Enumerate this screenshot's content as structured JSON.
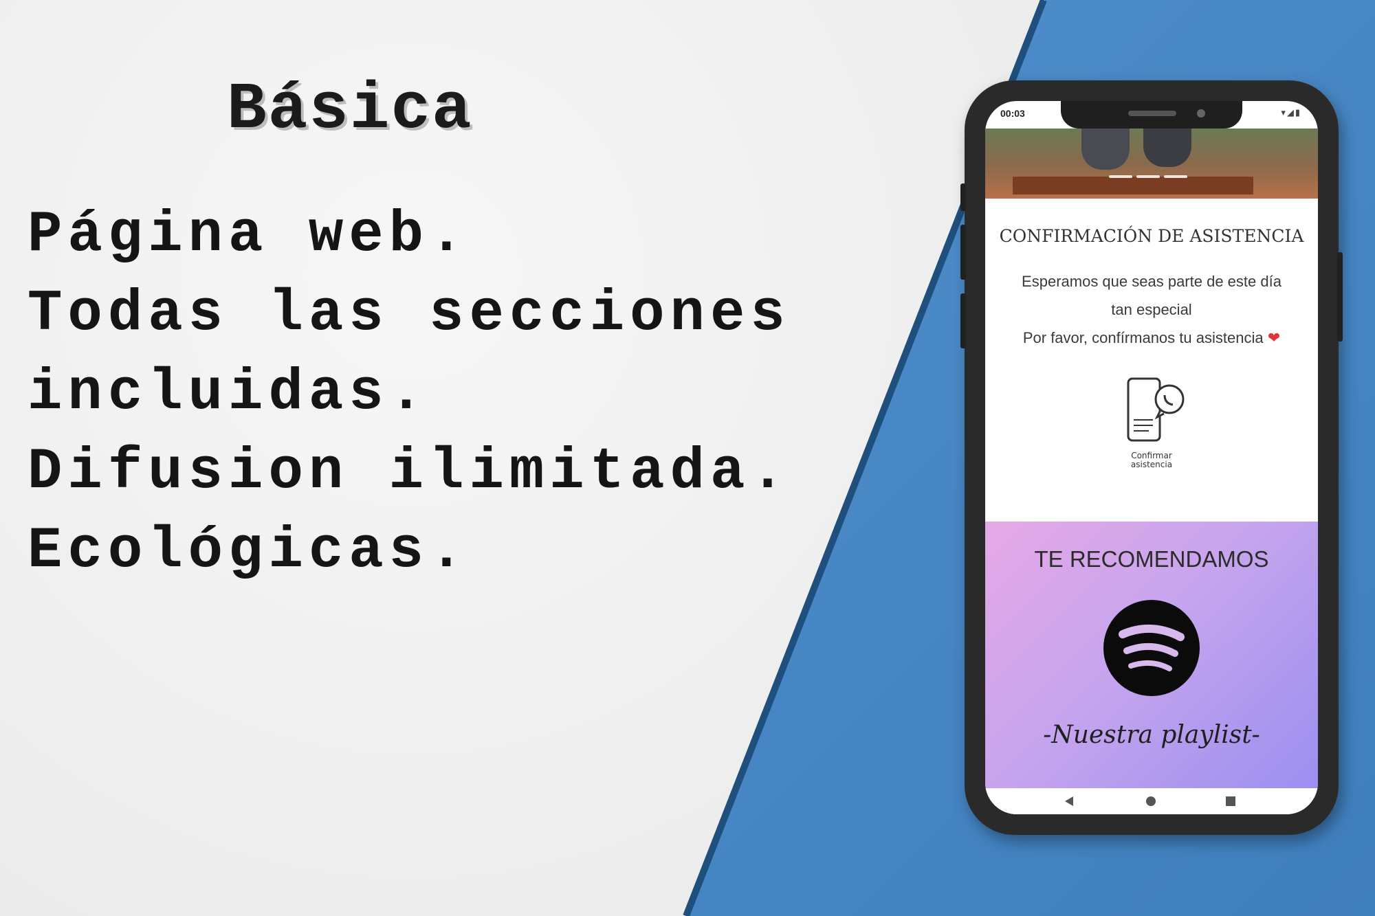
{
  "heading": "Básica",
  "features": [
    "Página web.",
    "Todas las secciones",
    "incluidas.",
    "Difusion ilimitada.",
    "Ecológicas."
  ],
  "phone": {
    "status_time": "00:03",
    "status_icons": "▾◢▮",
    "rsvp": {
      "title": "CONFIRMACIÓN DE ASISTENCIA",
      "line1": "Esperamos que seas parte de este día",
      "line2": "tan especial",
      "line3": "Por favor, confírmanos tu asistencia",
      "heart": "❤",
      "button_label_1": "Confirmar",
      "button_label_2": "asistencia",
      "icon": "phone-whatsapp-icon"
    },
    "recommend": {
      "title": "TE RECOMENDAMOS",
      "icon": "spotify-icon",
      "subtitle": "-Nuestra playlist-"
    },
    "nav": [
      "back-icon",
      "home-icon",
      "recent-apps-icon"
    ]
  },
  "colors": {
    "background_left": "#eeeeee",
    "background_right": "#4b8bc8",
    "phone_frame": "#2a2a2a",
    "recommend_gradient_start": "#e6a8e6",
    "recommend_gradient_end": "#9b8ff0",
    "heart": "#e2323a"
  }
}
